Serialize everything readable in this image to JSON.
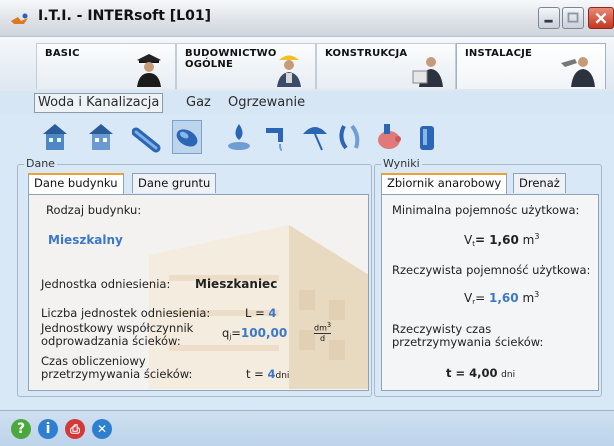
{
  "window": {
    "title": "I.T.I. - INTERsoft [L01]",
    "buttons": [
      "minimize-icon",
      "maximize-icon",
      "close-icon"
    ]
  },
  "modules": [
    {
      "label_line1": "BASIC",
      "label_line2": "",
      "icon": "graduate-figure-icon"
    },
    {
      "label_line1": "BUDOWNICTWO",
      "label_line2": "OGÓLNE",
      "icon": "builder-hardhat-icon"
    },
    {
      "label_line1": "KONSTRUKCJA",
      "label_line2": "",
      "icon": "engineer-figure-icon"
    },
    {
      "label_line1": "INSTALACJE",
      "label_line2": "",
      "icon": "plumber-figure-icon",
      "active": true
    }
  ],
  "categories": [
    {
      "label": "Woda i Kanalizacja",
      "active": true
    },
    {
      "label": "Gaz"
    },
    {
      "label": "Ogrzewanie"
    }
  ],
  "tools": [
    "house-water-icon",
    "house-sewer-icon",
    "pipe-icon",
    "tank-icon",
    "water-drop-icon",
    "faucet-icon",
    "umbrella-icon",
    "hose-icon",
    "pig-icon",
    "cylinder-tank-icon"
  ],
  "left_group": {
    "title": "Dane",
    "tabs": [
      {
        "label": "Dane budynku",
        "active": true
      },
      {
        "label": "Dane gruntu"
      }
    ],
    "building_type_label": "Rodzaj budynku:",
    "building_type_value": "Mieszkalny",
    "unit_label": "Jednostka odniesienia:",
    "unit_value": "Mieszkaniec",
    "count_label": "Liczba jednostek odniesienia:",
    "count_symbol": "L =",
    "count_value": "4",
    "coef_label_1": "Jednostkowy współczynnik",
    "coef_label_2": "odprowadzania ścieków:",
    "coef_symbol": "q",
    "coef_sub": "j",
    "coef_eq": "=",
    "coef_value": "100,00",
    "coef_unit_num": "dm",
    "coef_unit_sup": "3",
    "coef_unit_den": "d",
    "time_label_1": "Czas obliczeniowy",
    "time_label_2": "przetrzymywania ścieków:",
    "time_symbol": "t =",
    "time_value": "4",
    "time_unit": "dni"
  },
  "right_group": {
    "title": "Wyniki",
    "tabs": [
      {
        "label": "Zbiornik anarobowy",
        "active": true
      },
      {
        "label": "Drenaż"
      }
    ],
    "min_cap_label": "Minimalna pojemnośc użytkowa:",
    "min_cap_symbol": "V",
    "min_cap_sub": "t",
    "min_cap_value": "= 1,60",
    "min_cap_unit": "m",
    "min_cap_unit_sup": "3",
    "real_cap_label": "Rzeczywista pojemność użytkowa:",
    "real_cap_symbol": "V",
    "real_cap_sub": "r",
    "real_cap_eq": "=",
    "real_cap_value": "1,60",
    "real_cap_unit": "m",
    "real_cap_unit_sup": "3",
    "real_time_label_1": "Rzeczywisty czas",
    "real_time_label_2": "przetrzymywania ścieków:",
    "real_time_value": "t = 4,00",
    "real_time_unit": "dni"
  },
  "bottom_buttons": [
    {
      "icon": "help-icon",
      "glyph": "?",
      "color": "#4aa83c"
    },
    {
      "icon": "info-icon",
      "glyph": "i",
      "color": "#2f7fd0"
    },
    {
      "icon": "print-icon",
      "glyph": "⎙",
      "color": "#d23a3a"
    },
    {
      "icon": "tools-icon",
      "glyph": "✕",
      "color": "#2f7fd0"
    }
  ]
}
